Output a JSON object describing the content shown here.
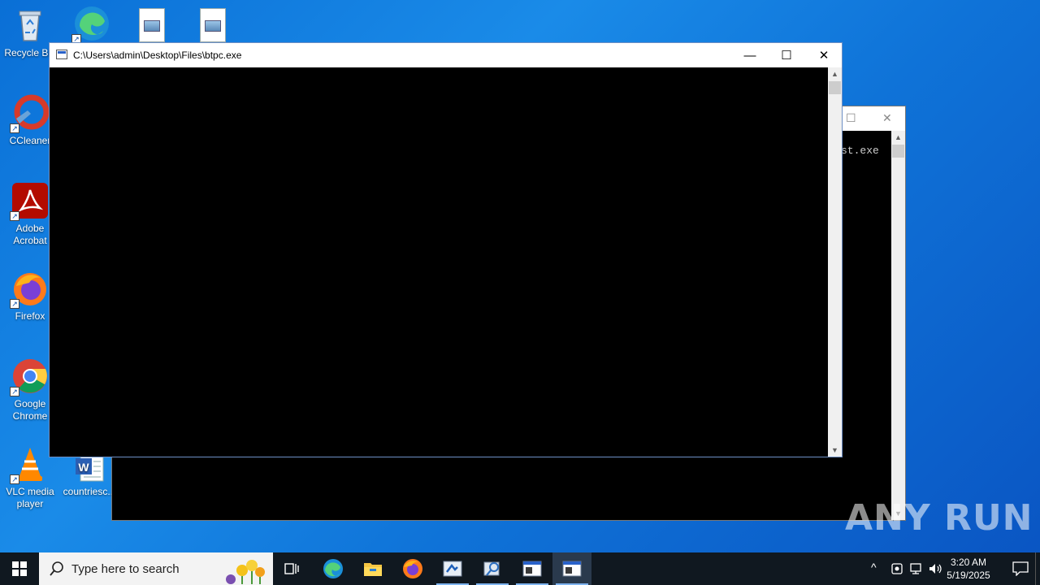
{
  "desktop": {
    "icons": [
      {
        "label": "Recycle Bin",
        "icon": "recycle-bin-icon"
      },
      {
        "label": "CCleaner",
        "icon": "ccleaner-icon"
      },
      {
        "label": "Adobe Acrobat",
        "icon": "acrobat-icon"
      },
      {
        "label": "Firefox",
        "icon": "firefox-icon"
      },
      {
        "label": "Google Chrome",
        "icon": "chrome-icon"
      },
      {
        "label": "VLC media player",
        "icon": "vlc-icon"
      },
      {
        "label": "countriesc...",
        "icon": "word-document-icon"
      }
    ]
  },
  "background_window": {
    "visible_text": "st.exe"
  },
  "main_window": {
    "title": "C:\\Users\\admin\\Desktop\\Files\\btpc.exe",
    "minimize": "—",
    "maximize": "☐",
    "close": "✕"
  },
  "watermark": "ANY RUN",
  "taskbar": {
    "search_placeholder": "Type here to search",
    "time": "3:20 AM",
    "date": "5/19/2025",
    "apps": [
      "task-view-icon",
      "edge-icon",
      "file-explorer-icon",
      "firefox-icon",
      "app-installer-icon",
      "search-tool-icon",
      "console-window-icon",
      "console-window-icon"
    ]
  },
  "colors": {
    "desktop_blue": "#0f73d8",
    "taskbar": "#101820",
    "console_bg": "#000000"
  }
}
